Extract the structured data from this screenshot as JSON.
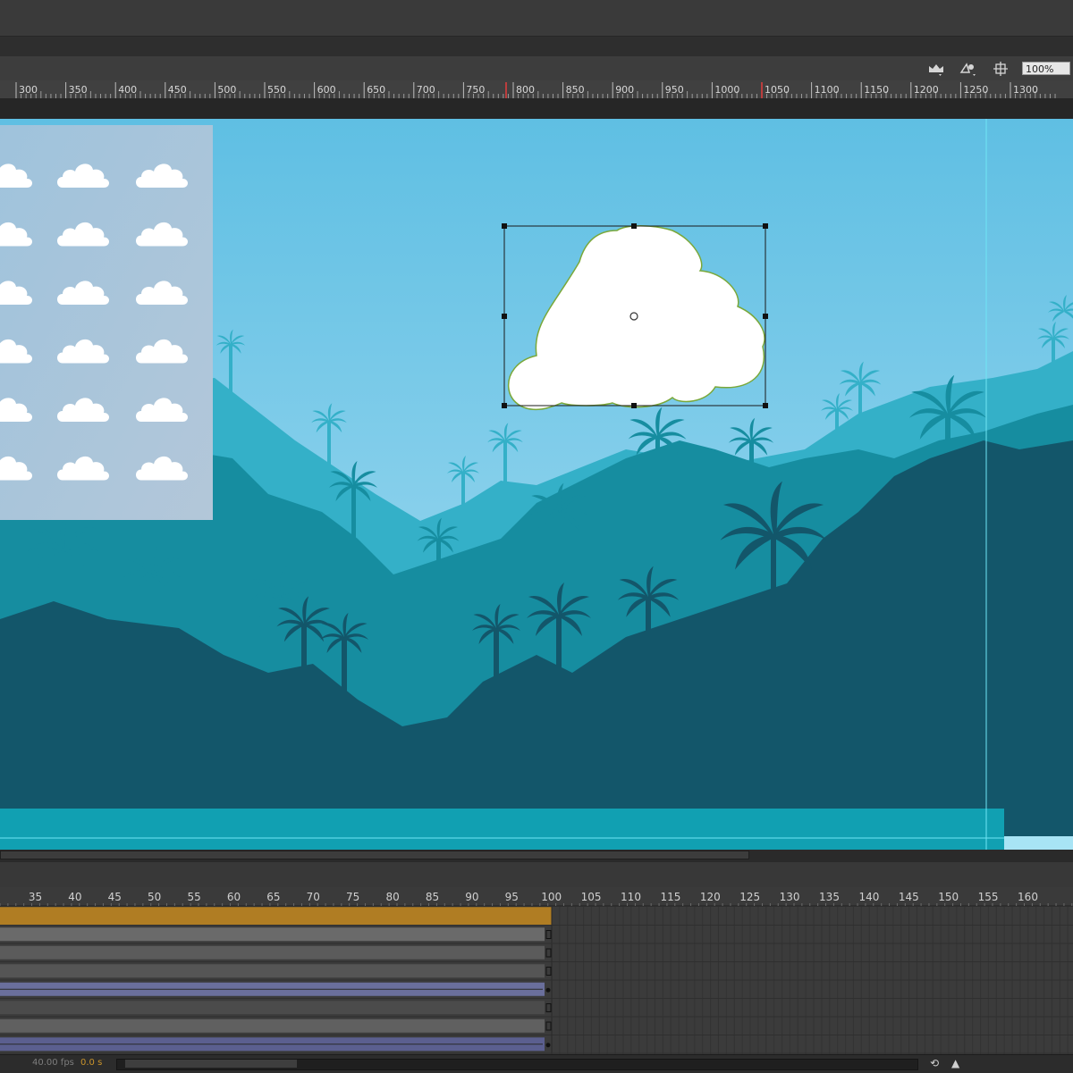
{
  "toolbar": {
    "zoom_value": "100%",
    "icons": [
      "edit-scene-icon",
      "symbol-edit-icon",
      "snap-icon"
    ]
  },
  "ruler": {
    "labels": [
      "300",
      "350",
      "400",
      "450",
      "500",
      "550",
      "600",
      "650",
      "700",
      "750",
      "800",
      "850",
      "900",
      "950",
      "1000",
      "1050",
      "1100",
      "1150",
      "1200",
      "1250",
      "1300"
    ]
  },
  "stage": {
    "sky_color": "#5fbfe3",
    "cloud_sheet_rows": 6,
    "cloud_sheet_columns": 3,
    "selected_object": "cloud"
  },
  "timeline": {
    "frame_labels": [
      "35",
      "40",
      "45",
      "50",
      "55",
      "60",
      "65",
      "70",
      "75",
      "80",
      "85",
      "90",
      "95",
      "100",
      "105",
      "110",
      "115",
      "120",
      "125",
      "130",
      "135",
      "140",
      "145",
      "150",
      "155",
      "160"
    ],
    "layer_colors": [
      "#b07d23",
      "#6a6a6a",
      "#5b5b5b",
      "#555555",
      "#6a6f9c",
      "#4b4b4b",
      "#606060",
      "#5b5f8f"
    ]
  },
  "status": {
    "fps": "40.00 fps",
    "time": "0.0 s"
  },
  "colors": {
    "accent_orange": "#c9932b",
    "playhead": "#e43c3c",
    "guide": "#6fe6f5"
  }
}
